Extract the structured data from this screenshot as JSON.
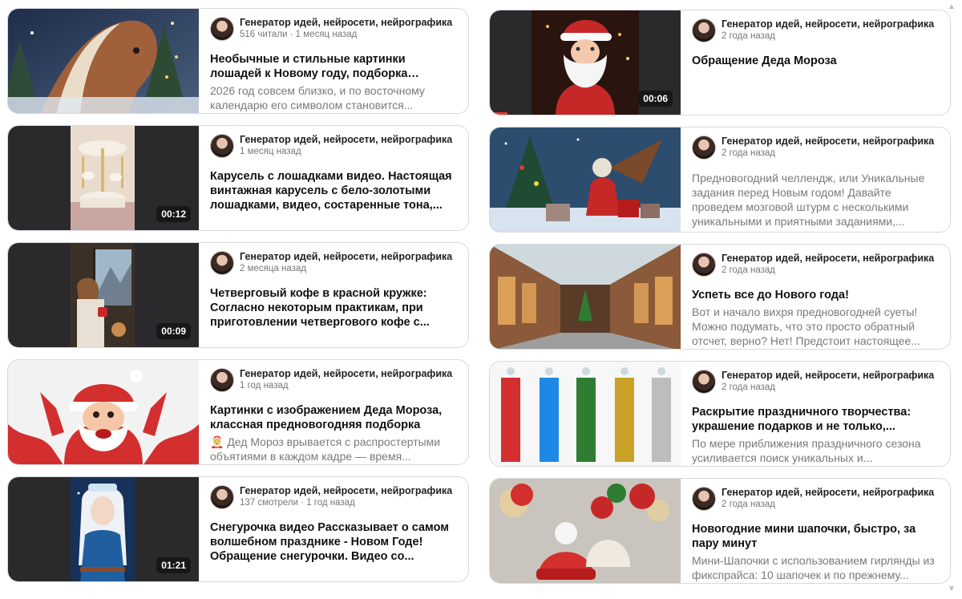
{
  "channel": "Генератор идей, нейросети, нейрографика",
  "left": [
    {
      "meta": "516 читали · 1 месяц назад",
      "title": "Необычные и стильные картинки лошадей к Новому году, подборка красивых...",
      "snippet": "2026 год совсем близко, и по восточному календарю его символом становится...",
      "duration": ""
    },
    {
      "meta": "1 месяц назад",
      "title": "Карусель с лошадками видео. Настоящая винтажная карусель с бело-золотыми лошадками, видео, состаренные тона,...",
      "snippet": "",
      "duration": "00:12"
    },
    {
      "meta": "2 месяца назад",
      "title": "Четверговый кофе в красной кружке: Согласно некоторым практикам, при приготовлении четвергового кофе с...",
      "snippet": "",
      "duration": "00:09"
    },
    {
      "meta": "1 год назад",
      "title": "Картинки с изображением Деда Мороза, классная предновогодняя подборка",
      "snippet": "🤶 Дед Мороз врывается с распростертыми объятиями в каждом кадре — время...",
      "duration": ""
    },
    {
      "meta": "137 смотрели · 1 год назад",
      "title": "Снегурочка видео Рассказывает о самом волшебном празднике - Новом Годе! Обращение снегурочки. Видео со...",
      "snippet": "",
      "duration": "01:21"
    }
  ],
  "right": [
    {
      "meta": "2 года назад",
      "title": "Обращение Деда Мороза",
      "snippet": "",
      "duration": "00:06"
    },
    {
      "meta": "2 года назад",
      "title": "",
      "snippet": "Предновогодний челлендж, или Уникальные задания перед Новым годом! Давайте проведем мозговой штурм с несколькими уникальными и приятными заданиями,...",
      "duration": ""
    },
    {
      "meta": "2 года назад",
      "title": "Успеть все до Нового года!",
      "snippet": "Вот и начало вихря предновогодней суеты! Можно подумать, что это просто обратный отсчет, верно? Нет! Предстоит настоящее...",
      "duration": ""
    },
    {
      "meta": "2 года назад",
      "title": "Раскрытие праздничного творчества: украшение подарков и не только,...",
      "snippet": "По мере приближения праздничного сезона усиливается поиск уникальных и...",
      "duration": ""
    },
    {
      "meta": "2 года назад",
      "title": "Новогодние мини шапочки, быстро, за пару минут",
      "snippet": "Мини-Шапочки с использованием гирлянды из фикспрайса: 10 шапочек и по прежнему...",
      "duration": ""
    }
  ],
  "icons": {
    "scroll_up": "scroll-up-arrow-icon",
    "scroll_down": "scroll-down-arrow-icon"
  },
  "colors": {
    "progress": "#e53935",
    "duration_bg": "#141414"
  }
}
